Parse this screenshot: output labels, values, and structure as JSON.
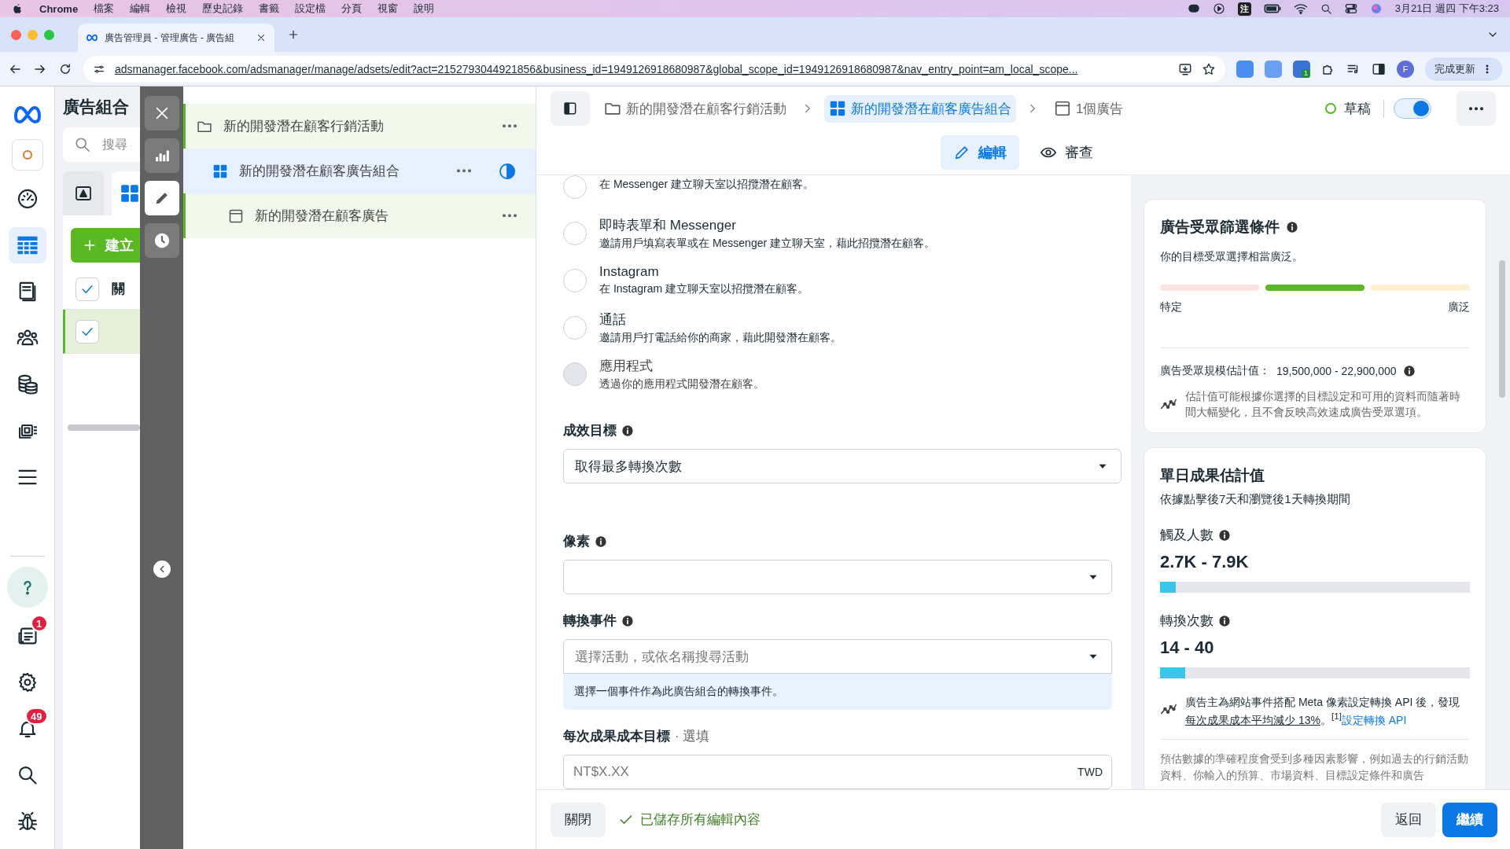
{
  "menubar": {
    "app": "Chrome",
    "menus": [
      "檔案",
      "編輯",
      "檢視",
      "歷史記錄",
      "書籤",
      "設定檔",
      "分頁",
      "視窗",
      "說明"
    ],
    "input_method": "注",
    "clock": "3月21日 週四 下午3:23"
  },
  "browser": {
    "tab_title": "廣告管理員 - 管理廣告 - 廣告組",
    "url": "adsmanager.facebook.com/adsmanager/manage/adsets/edit?act=2152793044921856&business_id=1949126918680987&global_scope_id=1949126918680987&nav_entry_point=am_local_scope...",
    "extension_badge": "1",
    "profile": "F",
    "update_button": "完成更新"
  },
  "nav_rail": {
    "items": [
      {
        "kind": "dashboard",
        "selected": false
      },
      {
        "kind": "table",
        "selected": true
      },
      {
        "kind": "documents",
        "selected": false
      },
      {
        "kind": "people",
        "selected": false
      },
      {
        "kind": "coins",
        "selected": false
      },
      {
        "kind": "media",
        "selected": false
      },
      {
        "kind": "menu",
        "selected": false
      }
    ],
    "bottom_items": [
      {
        "kind": "help"
      },
      {
        "kind": "news",
        "badge": "1"
      },
      {
        "kind": "settings"
      },
      {
        "kind": "bell",
        "badge": "49"
      },
      {
        "kind": "search"
      },
      {
        "kind": "bug"
      }
    ]
  },
  "adsets_panel": {
    "title": "廣告組合",
    "search_placeholder": "搜尋",
    "create_button": "建立",
    "header": {
      "checked": true,
      "label": "關"
    },
    "rows": [
      {
        "checked": true,
        "selected": true
      }
    ]
  },
  "toolbar": {
    "tools": [
      {
        "kind": "close",
        "selected": false
      },
      {
        "kind": "chart",
        "selected": false
      },
      {
        "kind": "edit",
        "selected": true
      },
      {
        "kind": "history",
        "selected": false
      }
    ]
  },
  "tree": [
    {
      "kind": "campaign",
      "label": "新的開發潛在顧客行銷活動",
      "selected": false,
      "children": [
        {
          "kind": "adset",
          "label": "新的開發潛在顧客廣告組合",
          "selected": true,
          "children": [
            {
              "kind": "ad",
              "label": "新的開發潛在顧客廣告",
              "selected": false
            }
          ]
        }
      ]
    }
  ],
  "header": {
    "breadcrumbs": [
      {
        "kind": "campaign",
        "label": "新的開發潛在顧客行銷活動",
        "selected": false
      },
      {
        "kind": "adset",
        "label": "新的開發潛在顧客廣告組合",
        "selected": true
      },
      {
        "kind": "ad",
        "label": "1個廣告",
        "selected": false
      }
    ],
    "status": "草稿",
    "toggle_on": true,
    "tabs": [
      {
        "kind": "edit",
        "label": "編輯",
        "selected": true
      },
      {
        "kind": "review",
        "label": "審查",
        "selected": false
      }
    ]
  },
  "form": {
    "options": [
      {
        "description": "在 Messenger 建立聊天室以招攬潛在顧客。",
        "selected": false,
        "disabled": false
      },
      {
        "title": "即時表單和 Messenger",
        "description": "邀請用戶填寫表單或在 Messenger 建立聊天室，藉此招攬潛在顧客。",
        "selected": false,
        "disabled": false
      },
      {
        "title": "Instagram",
        "description": "在 Instagram 建立聊天室以招攬潛在顧客。",
        "selected": false,
        "disabled": false
      },
      {
        "title": "通話",
        "description": "邀請用戶打電話給你的商家，藉此開發潛在顧客。",
        "selected": false,
        "disabled": false
      },
      {
        "title": "應用程式",
        "description": "透過你的應用程式開發潛在顧客。",
        "selected": false,
        "disabled": true
      }
    ],
    "fields": [
      {
        "kind": "select",
        "label": "成效目標",
        "info": true,
        "value": "取得最多轉換次數"
      },
      {
        "kind": "select",
        "label": "像素",
        "info": true
      },
      {
        "kind": "select",
        "label": "轉換事件",
        "info": true,
        "placeholder": "選擇活動，或依名稱搜尋活動",
        "hint": "選擇一個事件作為此廣告組合的轉換事件。"
      },
      {
        "kind": "input",
        "label": "每次成果成本目標",
        "optional": "· 選填",
        "info": false,
        "placeholder": "NT$X.XX",
        "suffix": "TWD"
      }
    ]
  },
  "audience": {
    "title": "廣告受眾篩選條件",
    "summary": "你的目標受眾選擇相當廣泛。",
    "segments": [
      {
        "selected": false
      },
      {
        "selected": true
      },
      {
        "selected": false
      }
    ],
    "left_label": "特定",
    "right_label": "廣泛",
    "size_label": "廣告受眾規模估計值：",
    "size_value": "19,500,000 - 22,900,000",
    "note": "估計值可能根據你選擇的目標設定和可用的資料而隨著時間大幅變化，且不會反映高效速成廣告受眾選項。"
  },
  "estimates": {
    "title": "單日成果估計值",
    "subtitle": "依據點擊後7天和瀏覽後1天轉換期間",
    "metrics": [
      {
        "label": "觸及人數",
        "value": "2.7K - 7.9K",
        "level": 0.05
      },
      {
        "label": "轉換次數",
        "value": "14 - 40",
        "level": 0.08
      }
    ],
    "note": {
      "text_before": "廣告主為網站事件搭配 Meta 像素設定轉換 API 後，發現",
      "underlined": "每次成果成本平均減少 13%",
      "text_after": "。$^{[1]}$",
      "link": "設定轉換 API"
    },
    "disclaimer": "預估數據的準確程度會受到多種因素影響，例如過去的行銷活動資料、你輸入的預算、市場資料、目標設定條件和廣告"
  },
  "footer": {
    "close": "關閉",
    "saved": "已儲存所有編輯內容",
    "back": "返回",
    "continue": "繼續"
  }
}
